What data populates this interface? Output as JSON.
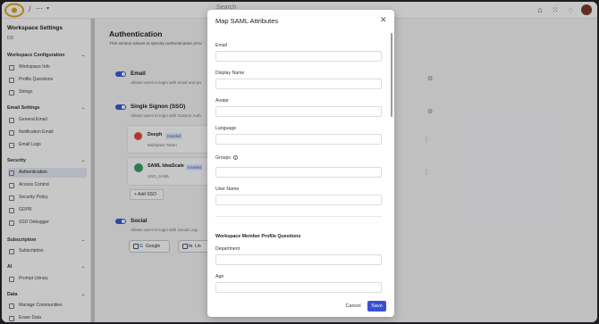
{
  "topbar": {
    "crumb": "⋯",
    "search_placeholder": "Search"
  },
  "sidebar": {
    "title": "Workspace Settings",
    "subtitle": "DD",
    "sections": [
      {
        "label": "Workspace Configuration",
        "items": [
          {
            "label": "Workspace Info",
            "icon": "info-icon"
          },
          {
            "label": "Profile Questions",
            "icon": "question-icon"
          },
          {
            "label": "Strings",
            "icon": "strings-icon"
          }
        ]
      },
      {
        "label": "Email Settings",
        "items": [
          {
            "label": "General Email",
            "icon": "mail-icon"
          },
          {
            "label": "Notification Email",
            "icon": "bell-icon"
          },
          {
            "label": "Email Logs",
            "icon": "log-icon"
          }
        ]
      },
      {
        "label": "Security",
        "items": [
          {
            "label": "Authentication",
            "icon": "key-icon",
            "active": true
          },
          {
            "label": "Access Control",
            "icon": "lock-icon"
          },
          {
            "label": "Security Policy",
            "icon": "shield-icon"
          },
          {
            "label": "GDPR",
            "icon": "document-icon"
          },
          {
            "label": "SSO Debugger",
            "icon": "bug-icon"
          }
        ]
      },
      {
        "label": "Subscription",
        "items": [
          {
            "label": "Subscription",
            "icon": "card-icon"
          }
        ]
      },
      {
        "label": "AI",
        "items": [
          {
            "label": "Prompt Library",
            "icon": "sparkle-icon"
          }
        ]
      },
      {
        "label": "Data",
        "items": [
          {
            "label": "Manage Communities",
            "icon": "community-icon"
          },
          {
            "label": "Erase Data",
            "icon": "trash-icon"
          }
        ]
      }
    ]
  },
  "main": {
    "title": "Authentication",
    "description": "This section allows to specify authentication prov",
    "email": {
      "title": "Email",
      "desc": "Allows users to login with email and pa"
    },
    "sso": {
      "title": "Single Signon (SSO)",
      "desc": "Allows users to login with Custom Auth"
    },
    "providers": [
      {
        "name": "Deeph",
        "badge": "Enabled",
        "sub": "Multipass Token"
      },
      {
        "name": "SAML IdeaScale",
        "badge": "Enabled",
        "sub": "SSO_SAML"
      }
    ],
    "add_sso": "Add SSO",
    "social": {
      "title": "Social",
      "desc": "Allows users to login with Social Logi"
    },
    "social_buttons": [
      {
        "label": "Google",
        "glyph": "G"
      },
      {
        "label": "Lin",
        "glyph": "in"
      }
    ]
  },
  "modal": {
    "title": "Map SAML Attributes",
    "fields": [
      {
        "label": "Email",
        "value": ""
      },
      {
        "label": "Display Name",
        "value": ""
      },
      {
        "label": "Avatar",
        "value": ""
      },
      {
        "label": "Language",
        "value": ""
      },
      {
        "label": "Groups",
        "value": "",
        "info": true
      },
      {
        "label": "User Name",
        "value": ""
      }
    ],
    "section_title": "Workspace Member Profile Questions",
    "profile_fields": [
      {
        "label": "Department",
        "value": ""
      },
      {
        "label": "Age",
        "value": ""
      }
    ],
    "cancel_label": "Cancel",
    "save_label": "Save"
  }
}
